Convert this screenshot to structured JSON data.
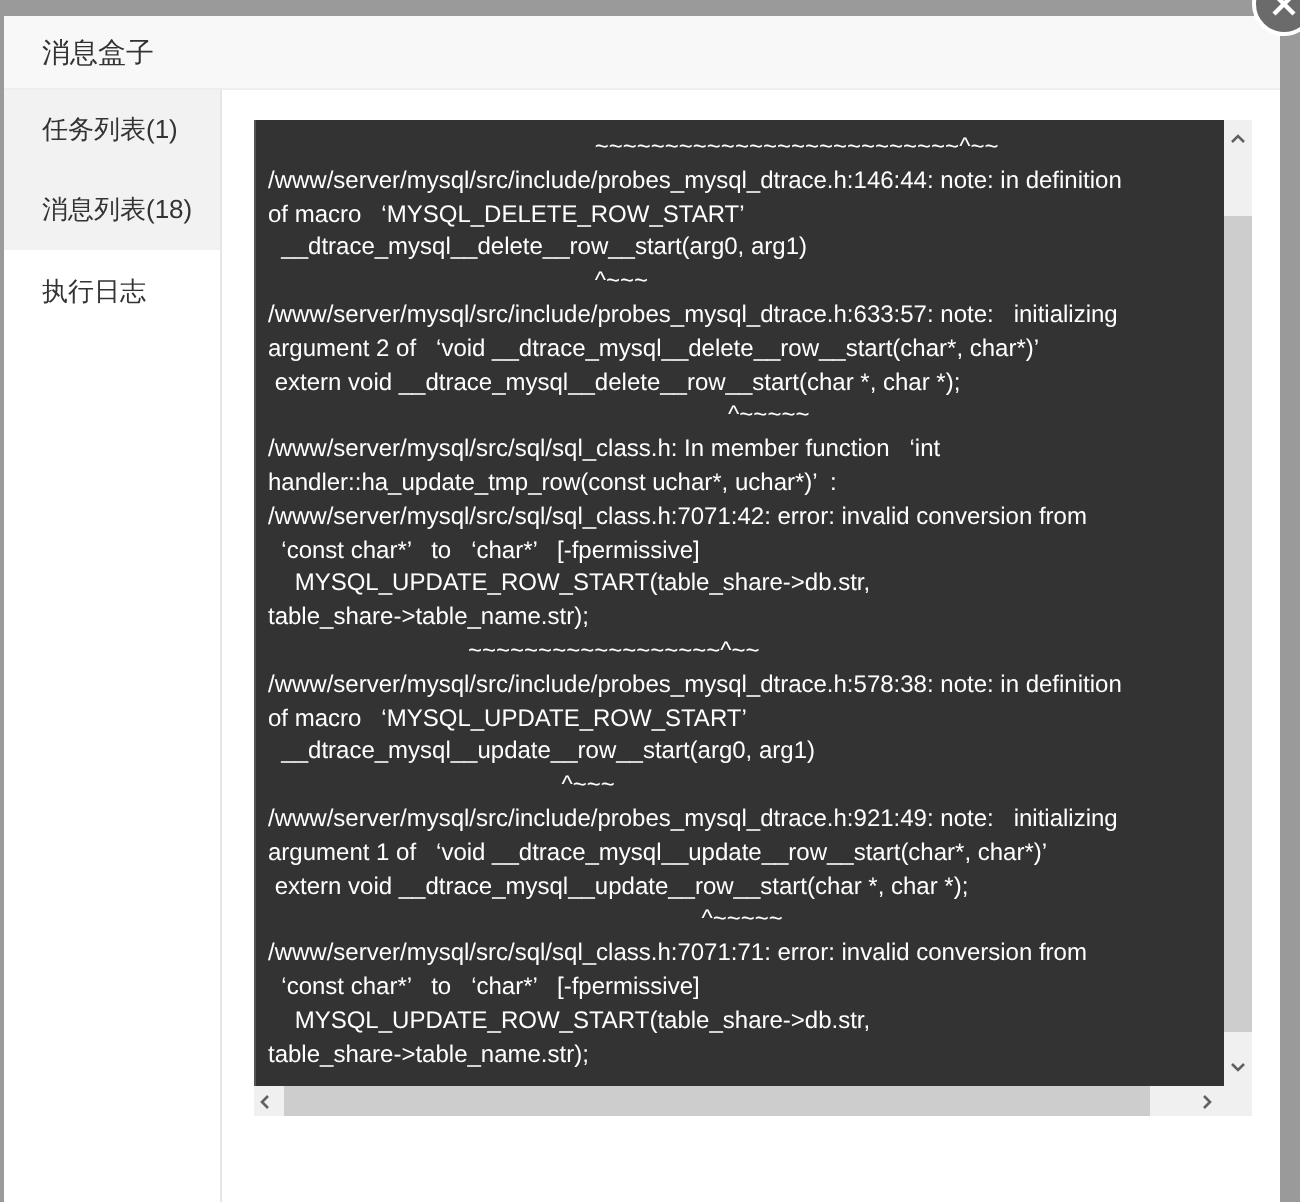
{
  "dialog": {
    "title": "消息盒子"
  },
  "tabs": [
    {
      "label": "任务列表(1)",
      "selected": false
    },
    {
      "label": "消息列表(18)",
      "selected": false
    },
    {
      "label": "执行日志",
      "selected": true
    }
  ],
  "log": {
    "lines": [
      "                                                 ~~~~~~~~~~~~~~~~~~~~~~~~~~^~~",
      "/www/server/mysql/src/include/probes_mysql_dtrace.h:146:44: note: in definition",
      "of macro   ‘MYSQL_DELETE_ROW_START’",
      "  __dtrace_mysql__delete__row__start(arg0, arg1)",
      "                                                 ^~~~",
      "/www/server/mysql/src/include/probes_mysql_dtrace.h:633:57: note:   initializing",
      "argument 2 of   ‘void __dtrace_mysql__delete__row__start(char*, char*)’",
      " extern void __dtrace_mysql__delete__row__start(char *, char *);",
      "                                                                     ^~~~~~",
      "/www/server/mysql/src/sql/sql_class.h: In member function   ‘int",
      "handler::ha_update_tmp_row(const uchar*, uchar*)’  :",
      "/www/server/mysql/src/sql/sql_class.h:7071:42: error: invalid conversion from",
      "  ‘const char*’   to   ‘char*’   [-fpermissive]",
      "    MYSQL_UPDATE_ROW_START(table_share->db.str,",
      "table_share->table_name.str);",
      "                              ~~~~~~~~~~~~~~~~~~^~~",
      "/www/server/mysql/src/include/probes_mysql_dtrace.h:578:38: note: in definition",
      "of macro   ‘MYSQL_UPDATE_ROW_START’",
      "  __dtrace_mysql__update__row__start(arg0, arg1)",
      "                                            ^~~~",
      "/www/server/mysql/src/include/probes_mysql_dtrace.h:921:49: note:   initializing",
      "argument 1 of   ‘void __dtrace_mysql__update__row__start(char*, char*)’",
      " extern void __dtrace_mysql__update__row__start(char *, char *);",
      "                                                                 ^~~~~~",
      "/www/server/mysql/src/sql/sql_class.h:7071:71: error: invalid conversion from",
      "  ‘const char*’   to   ‘char*’   [-fpermissive]",
      "    MYSQL_UPDATE_ROW_START(table_share->db.str,",
      "table_share->table_name.str);"
    ]
  }
}
